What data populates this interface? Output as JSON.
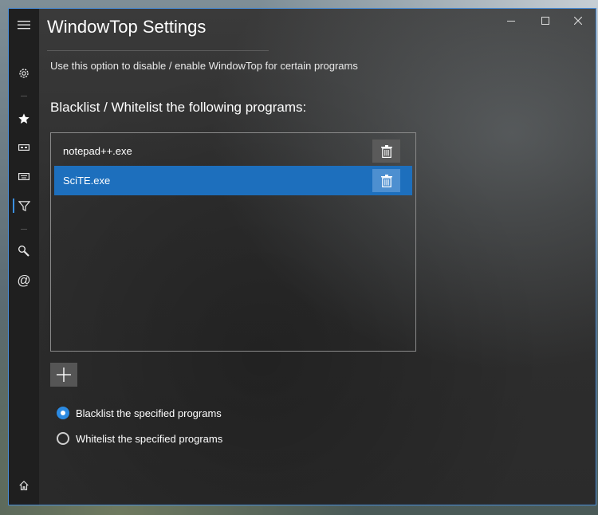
{
  "window": {
    "title": "WindowTop Settings",
    "caption_buttons": {
      "minimize": "minimize-icon",
      "maximize": "maximize-icon",
      "close": "close-icon"
    }
  },
  "sidebar": {
    "items": [
      {
        "name": "menu",
        "icon": "hamburger-icon"
      },
      {
        "name": "settings",
        "icon": "gear-icon"
      },
      {
        "name": "favorites",
        "icon": "star-icon"
      },
      {
        "name": "window-options",
        "icon": "window-bar-icon"
      },
      {
        "name": "keyboard",
        "icon": "keyboard-icon"
      },
      {
        "name": "filter",
        "icon": "filter-icon",
        "active": true
      },
      {
        "name": "tools",
        "icon": "wrench-icon"
      },
      {
        "name": "contact",
        "icon": "at-icon"
      },
      {
        "name": "home",
        "icon": "home-icon"
      }
    ]
  },
  "main": {
    "description": "Use this option to disable / enable WindowTop for certain programs",
    "heading": "Blacklist / Whitelist the following programs:",
    "programs": [
      {
        "name": "notepad++.exe",
        "selected": false
      },
      {
        "name": "SciTE.exe",
        "selected": true
      }
    ],
    "add_button_icon": "plus-icon",
    "delete_button_icon": "trash-icon",
    "mode_options": [
      {
        "label": "Blacklist the specified programs",
        "checked": true
      },
      {
        "label": "Whitelist the specified programs",
        "checked": false
      }
    ]
  },
  "colors": {
    "accent": "#1d6fbd",
    "radio_checked": "#2b8ae2",
    "window_border": "#4a8ed8"
  }
}
